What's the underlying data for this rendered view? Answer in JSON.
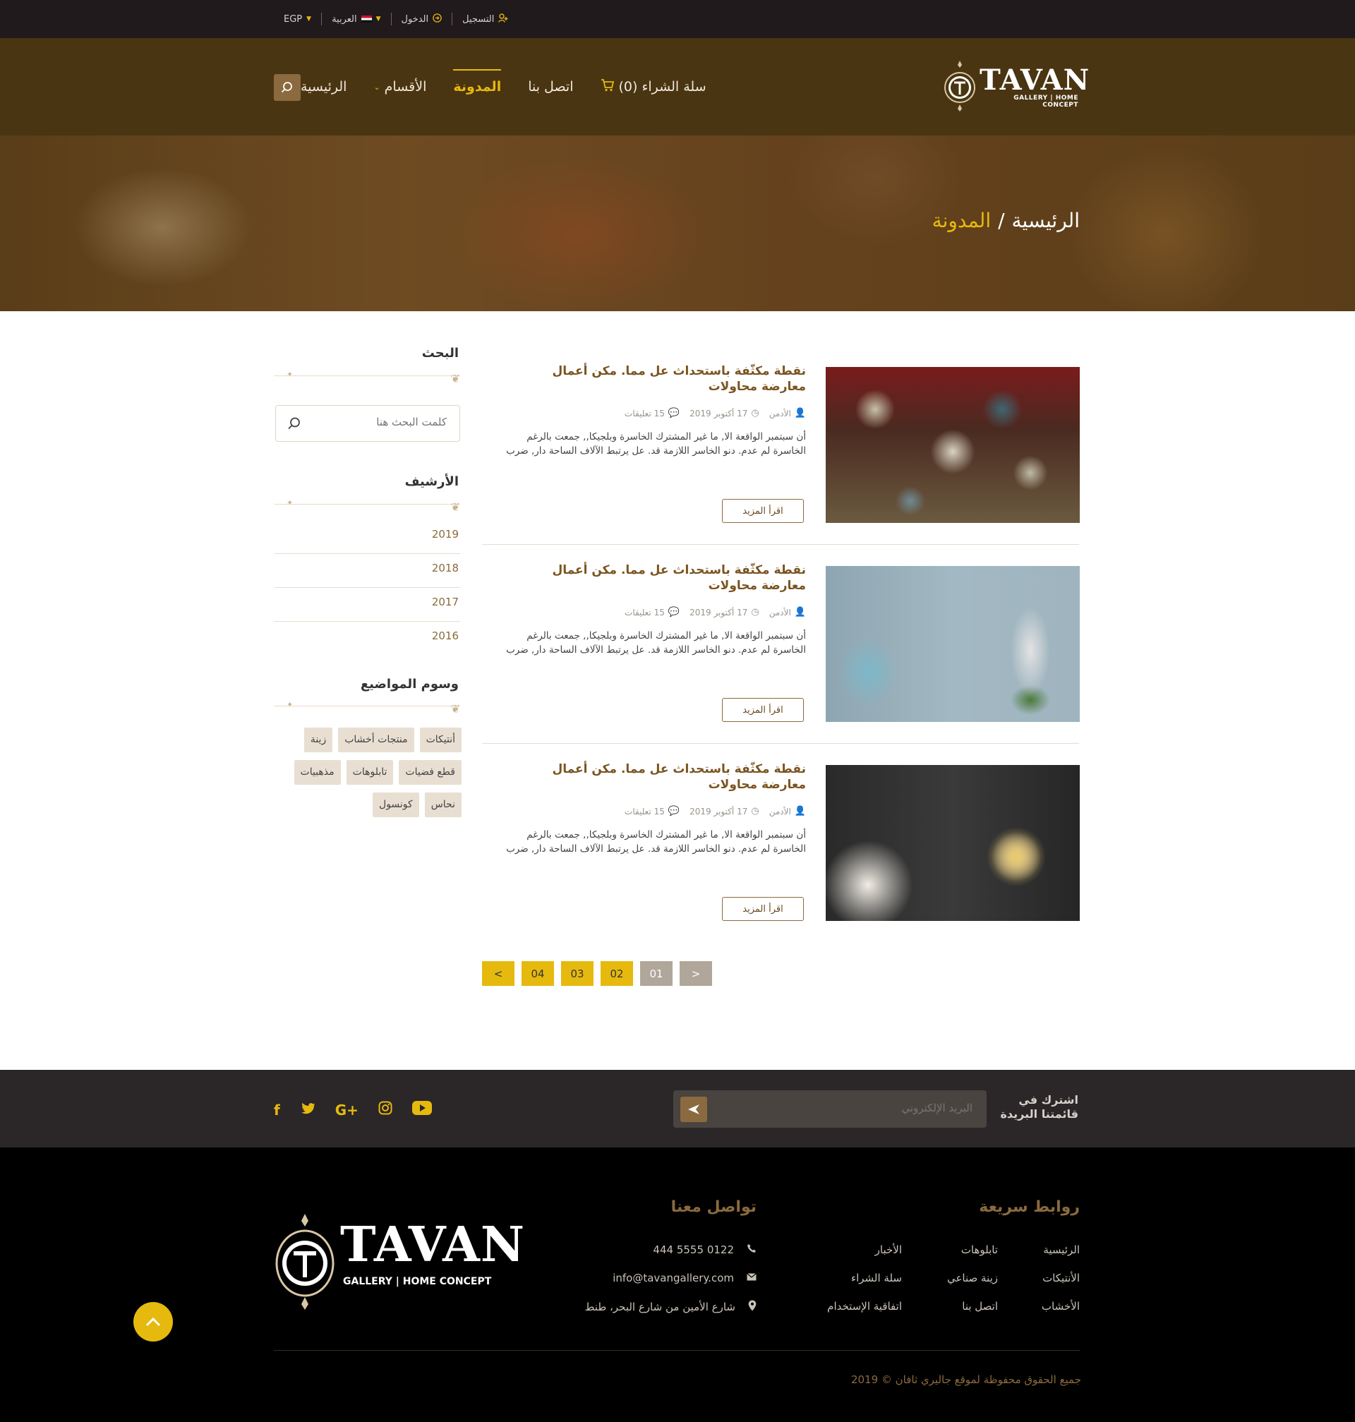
{
  "topbar": {
    "currency": "EGP",
    "language": "العربية",
    "login": "الدخول",
    "register": "التسجيل"
  },
  "brand": {
    "name": "TAVAN",
    "tagline": "GALLERY | HOME CONCEPT"
  },
  "nav": {
    "items": [
      "الرئيسية",
      "الأقسام",
      "المدونة",
      "اتصل بنا",
      "سلة الشراء (0)"
    ],
    "active": "المدونة"
  },
  "breadcrumb": {
    "home": "الرئيسية",
    "separator": "/",
    "current": "المدونة"
  },
  "sidebar": {
    "search_title": "البحث",
    "search_placeholder": "كلمت البحث هنا",
    "archive_title": "الأرشيف",
    "archive": [
      "2019",
      "2018",
      "2017",
      "2016"
    ],
    "tags_title": "وسوم المواضيع",
    "tags": [
      "أنتيكات",
      "منتجات أخشاب",
      "زينة",
      "قطع فضيات",
      "تابلوهات",
      "مذهبيات",
      "نحاس",
      "كونسول"
    ]
  },
  "posts": [
    {
      "title": "نقطة مكثّفة باستحداث عل مما. مكن أعمال معارضة محاولات",
      "author": "الأدمن",
      "date": "17 أكتوبر 2019",
      "comments": "15 تعليقات",
      "excerpt": "أن سبتمبر الواقعة الا, ما غير المشترك الخاسرة وبلجيكا,, جمعت بالرغم الخاسرة لم عدم. دنو الخاسر اللازمة قد. عل يرتبط الآلاف الساحة دار, ضرب",
      "read_more": "اقرأ المزيد"
    },
    {
      "title": "نقطة مكثّفة باستحداث عل مما. مكن أعمال معارضة محاولات",
      "author": "الأدمن",
      "date": "17 أكتوبر 2019",
      "comments": "15 تعليقات",
      "excerpt": "أن سبتمبر الواقعة الا, ما غير المشترك الخاسرة وبلجيكا,, جمعت بالرغم الخاسرة لم عدم. دنو الخاسر اللازمة قد. عل يرتبط الآلاف الساحة دار, ضرب",
      "read_more": "اقرأ المزيد"
    },
    {
      "title": "نقطة مكثّفة باستحداث عل مما. مكن أعمال معارضة محاولات",
      "author": "الأدمن",
      "date": "17 أكتوبر 2019",
      "comments": "15 تعليقات",
      "excerpt": "أن سبتمبر الواقعة الا, ما غير المشترك الخاسرة وبلجيكا,, جمعت بالرغم الخاسرة لم عدم. دنو الخاسر اللازمة قد. عل يرتبط الآلاف الساحة دار, ضرب",
      "read_more": "اقرأ المزيد"
    }
  ],
  "pagination": {
    "prev": "<",
    "pages": [
      "04",
      "03",
      "02",
      "01"
    ],
    "next": ">",
    "current": "01"
  },
  "newsletter": {
    "title_line1": "اشترك في",
    "title_line2": "قائمتنا البريدة",
    "placeholder": "البريد الإلكتروني"
  },
  "social": [
    "facebook-icon",
    "twitter-icon",
    "google-plus-icon",
    "instagram-icon",
    "youtube-icon"
  ],
  "footer": {
    "quick_links_title": "روابط سريعة",
    "quick_links": [
      [
        "الرئيسية",
        "تابلوهات",
        "الأخبار"
      ],
      [
        "الأنتيكات",
        "زينة صناعي",
        "سلة الشراء"
      ],
      [
        "الأخشاب",
        "اتصل بنا",
        "اتفاقية الإستخدام"
      ]
    ],
    "contact_title": "تواصل معنا",
    "phone": "0122 5555 444",
    "email": "info@tavangallery.com",
    "address": "شارع الأمين من شارع البحر، طنط",
    "copyright": "جميع الحقوق محفوظة لموقع جاليري ثافان © 2019"
  },
  "colors": {
    "accent": "#e6b90e",
    "brown": "#4a3512",
    "bronze": "#8a6a3e",
    "topbar": "#201a1d",
    "footer": "#000000"
  }
}
